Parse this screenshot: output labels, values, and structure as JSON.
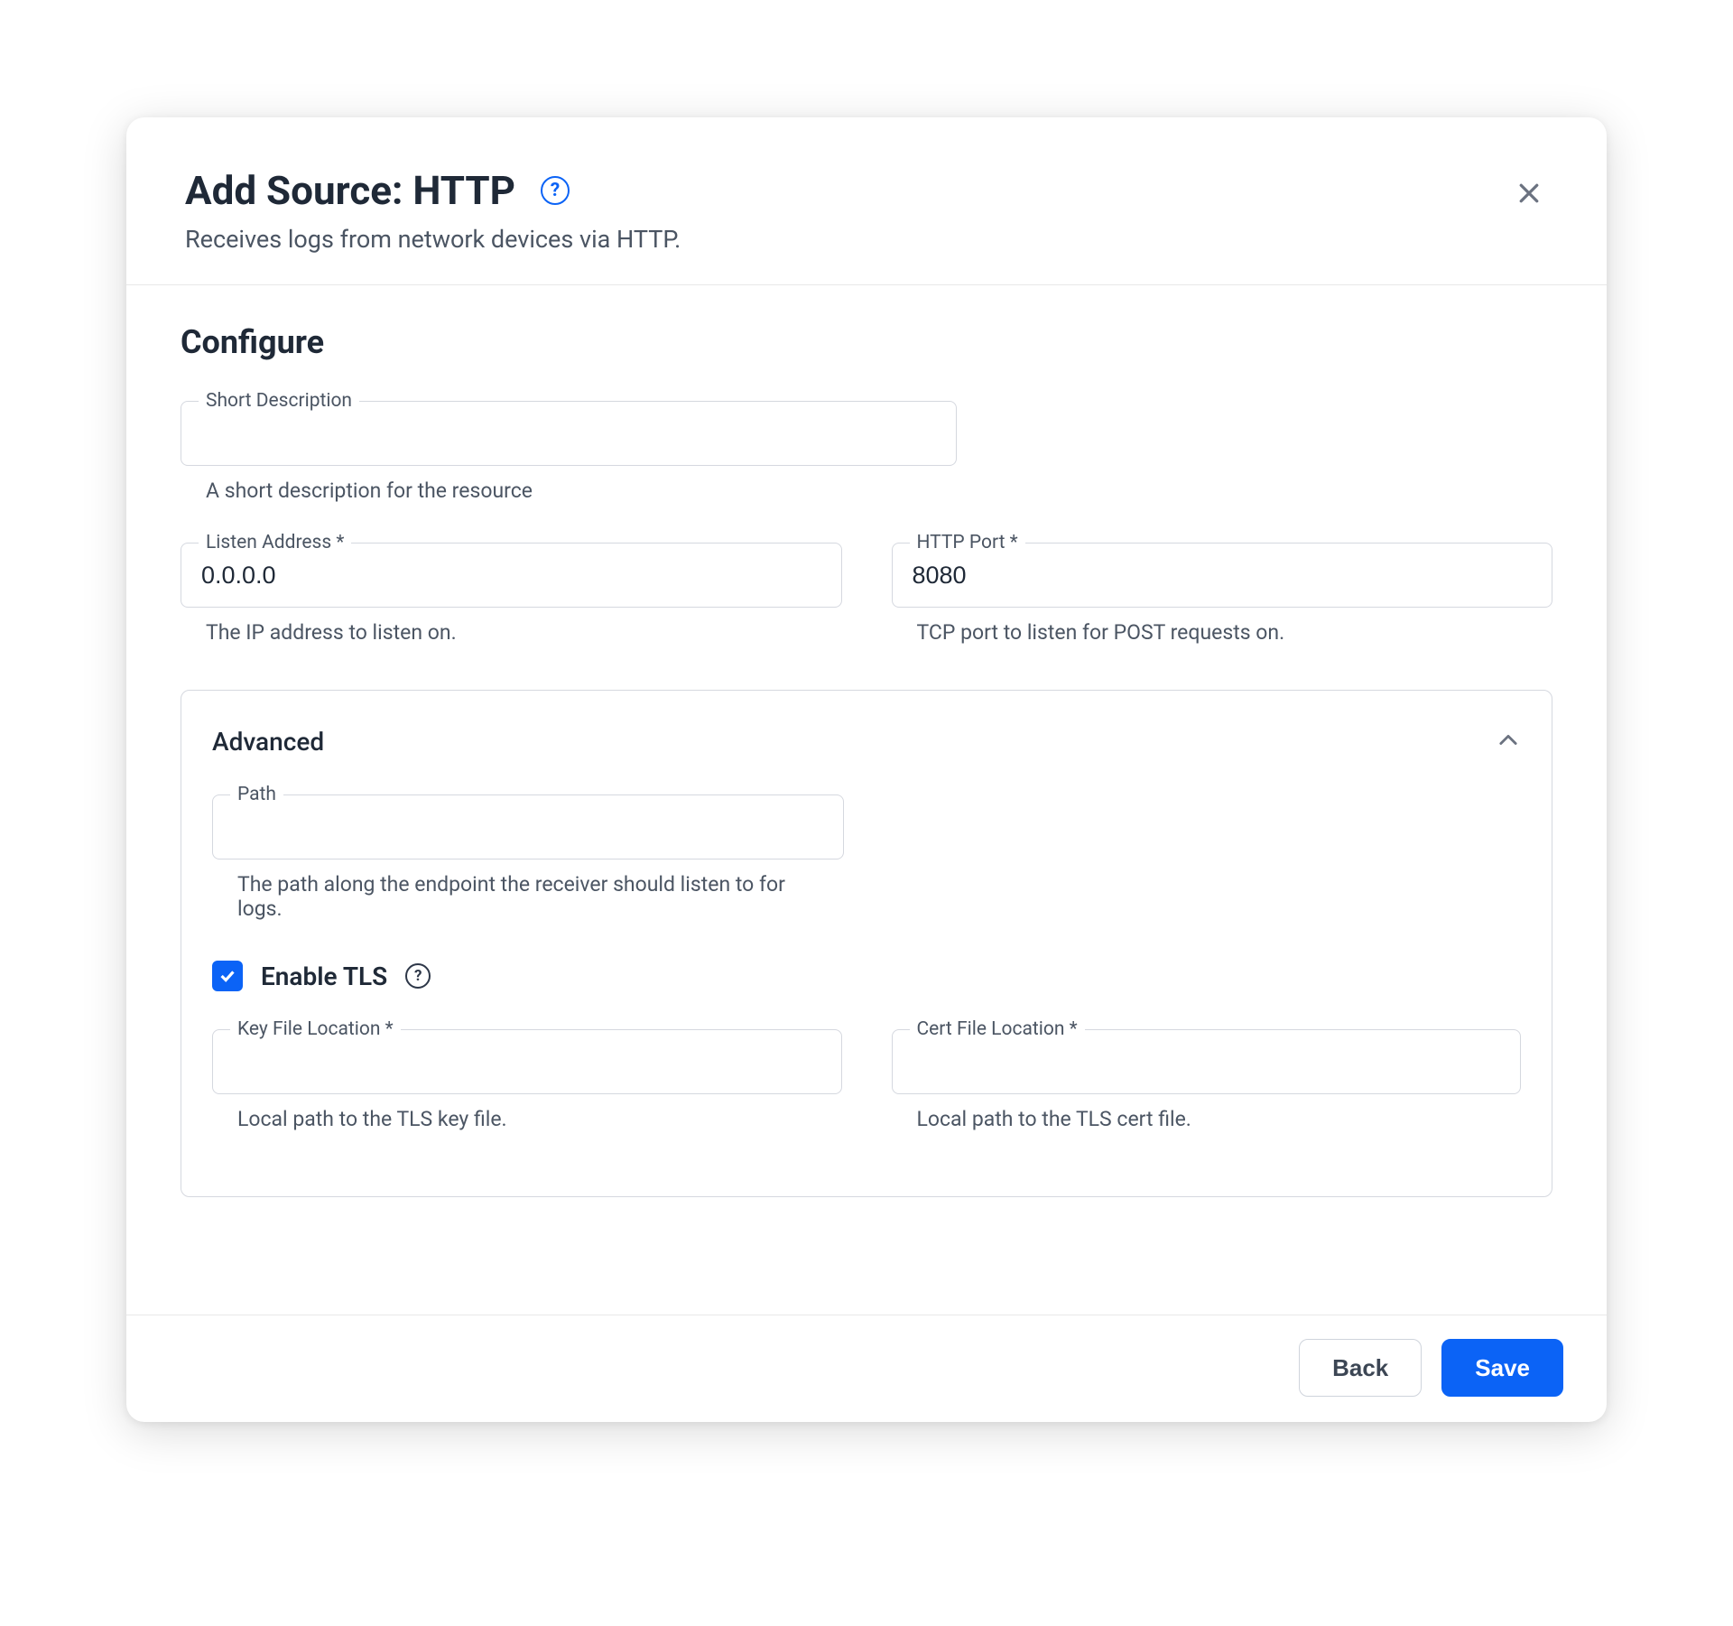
{
  "header": {
    "title": "Add Source: HTTP",
    "subtitle": "Receives logs from network devices via HTTP."
  },
  "section_title": "Configure",
  "fields": {
    "short_description": {
      "label": "Short Description",
      "value": "",
      "helper": "A short description for the resource"
    },
    "listen_address": {
      "label": "Listen Address *",
      "value": "0.0.0.0",
      "helper": "The IP address to listen on."
    },
    "http_port": {
      "label": "HTTP Port *",
      "value": "8080",
      "helper": "TCP port to listen for POST requests on."
    }
  },
  "advanced": {
    "title": "Advanced",
    "path": {
      "label": "Path",
      "value": "",
      "helper": "The path along the endpoint the receiver should listen to for logs."
    },
    "enable_tls": {
      "label": "Enable TLS",
      "checked": true
    },
    "key_file": {
      "label": "Key File Location *",
      "value": "",
      "helper": "Local path to the TLS key file."
    },
    "cert_file": {
      "label": "Cert File Location *",
      "value": "",
      "helper": "Local path to the TLS cert file."
    }
  },
  "footer": {
    "back": "Back",
    "save": "Save"
  }
}
